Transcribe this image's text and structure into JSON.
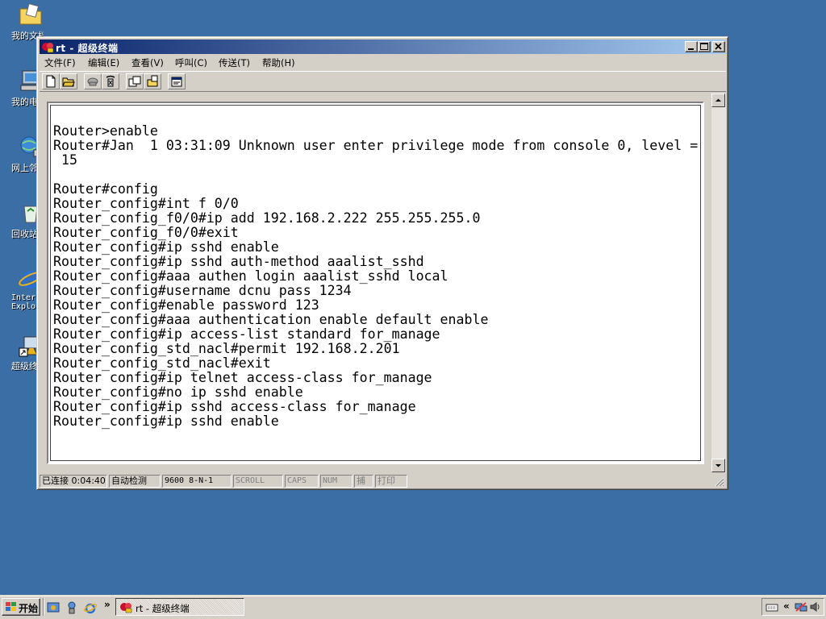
{
  "desktop": {
    "icons": [
      {
        "label": "我的文档",
        "icon": "folder-documents-icon"
      },
      {
        "label": "我的电脑",
        "icon": "my-computer-icon"
      },
      {
        "label": "网上邻居",
        "icon": "network-places-icon"
      },
      {
        "label": "回收站",
        "icon": "recycle-bin-icon"
      },
      {
        "label": "Internet Explorer",
        "icon": "internet-explorer-icon"
      },
      {
        "label": "超级终端",
        "icon": "hyperterminal-shortcut-icon"
      }
    ]
  },
  "window": {
    "title": "rt - 超级终端",
    "menu": [
      "文件(F)",
      "编辑(E)",
      "查看(V)",
      "呼叫(C)",
      "传送(T)",
      "帮助(H)"
    ],
    "toolbar": [
      "new-icon",
      "open-icon",
      "dial-icon",
      "disconnect-icon",
      "send-icon",
      "receive-icon",
      "properties-icon"
    ],
    "terminal_lines": [
      "Router>enable",
      "Router#Jan  1 03:31:09 Unknown user enter privilege mode from console 0, level =",
      " 15",
      "",
      "Router#config",
      "Router_config#int f 0/0",
      "Router_config_f0/0#ip add 192.168.2.222 255.255.255.0",
      "Router_config_f0/0#exit",
      "Router_config#ip sshd enable",
      "Router_config#ip sshd auth-method aaalist_sshd",
      "Router_config#aaa authen login aaalist_sshd local",
      "Router_config#username dcnu pass 1234",
      "Router_config#enable password 123",
      "Router_config#aaa authentication enable default enable",
      "Router_config#ip access-list standard for_manage",
      "Router_config_std_nacl#permit 192.168.2.201",
      "Router_config_std_nacl#exit",
      "Router config#ip telnet access-class for_manage",
      "Router_config#no ip sshd enable",
      "Router_config#ip sshd access-class for_manage",
      "Router_config#ip sshd enable"
    ],
    "status": {
      "connected": "已连接 0:04:40",
      "detect": "自动检测",
      "port": "9600 8-N-1",
      "scroll": "SCROLL",
      "caps": "CAPS",
      "num": "NUM",
      "capture": "捕",
      "print": "打印"
    }
  },
  "taskbar": {
    "start_label": "开始",
    "chevron": "»",
    "task_title": "rt - 超级终端",
    "tray_chevron": "«"
  },
  "colors": {
    "desktop": "#3a6ea5",
    "title_start": "#0a246a",
    "title_end": "#a6caf0",
    "face": "#d4d0c8"
  }
}
